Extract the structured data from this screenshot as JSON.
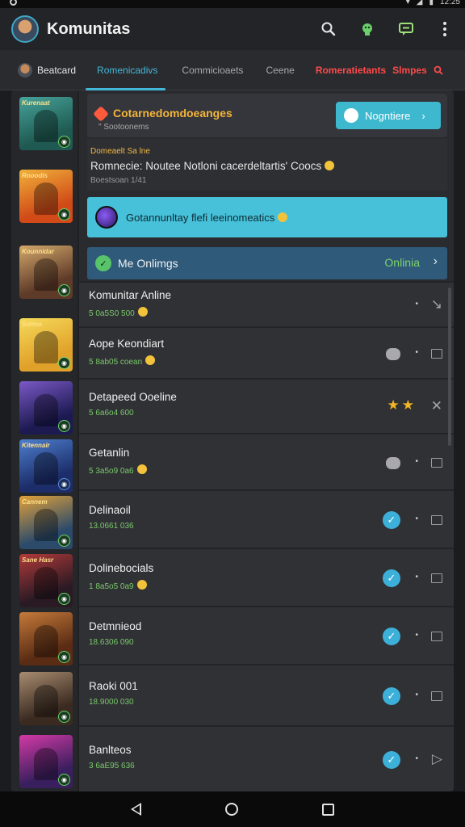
{
  "app": {
    "title": "Komunitas"
  },
  "statusbar": {
    "time": "12:25"
  },
  "appbar_icons": [
    "search-icon",
    "android-icon",
    "chat-icon",
    "more-vert-icon"
  ],
  "tabs": [
    {
      "label": "Beatcard"
    },
    {
      "label": "Romenicadivs"
    },
    {
      "label": "Commicioaets"
    },
    {
      "label": "Ceene"
    },
    {
      "label": "Romeratietants",
      "extra": "Slmpes"
    }
  ],
  "header": {
    "title": "Cotarnedomdoeanges",
    "sub": "\" Sootoonems",
    "join_label": "Nogntiere"
  },
  "notice": {
    "label": "Domeaelt Sa lne",
    "text": "Romnecie: Noutee Notloni cacerdeltartis' Coocs",
    "sub": "Boestsoan 1/41"
  },
  "banner": {
    "text": "Gotannunltay flefi leeinomeatics"
  },
  "online_bar": {
    "label": "Me Onlimgs",
    "status": "Onlinia"
  },
  "rows": [
    {
      "name": "Komunitar Anline",
      "sub": "5 0a5S0 500",
      "emoji": true,
      "dot": "•",
      "end": "arrow"
    },
    {
      "name": "Aope Keondiart",
      "sub": "5 8ab05 coean",
      "emoji": true,
      "dot": "•",
      "end": "box",
      "icon": "blob"
    },
    {
      "name": "Detapeed Ooeline",
      "sub": "5 6a6o4 600",
      "emoji": false,
      "end": "x",
      "icon": "stars"
    },
    {
      "name": "Getanlin",
      "sub": "5 3a5o9 0a6",
      "emoji": true,
      "dot": "•",
      "end": "box",
      "icon": "blob"
    },
    {
      "name": "Delinaoil",
      "sub": "13.0661 036",
      "emoji": false,
      "dot": "•",
      "end": "box",
      "icon": "check"
    },
    {
      "name": "Dolinebocials",
      "sub": "1 8a5o5 0a9",
      "emoji": true,
      "dot": "•",
      "end": "box",
      "icon": "check"
    },
    {
      "name": "Detmnieod",
      "sub": "18.6306 090",
      "emoji": false,
      "dot": "•",
      "end": "box",
      "icon": "check"
    },
    {
      "name": "Raoki 001",
      "sub": "18.9000 030",
      "emoji": false,
      "dot": "•",
      "end": "box",
      "icon": "check"
    },
    {
      "name": "Banlteos",
      "sub": "3 6aE95 636",
      "emoji": false,
      "dot": "•",
      "end": "play",
      "icon": "check"
    }
  ],
  "thumbs": [
    {
      "title": "Kurenaat",
      "colors": [
        "#1f5a52",
        "#46a39a"
      ]
    },
    {
      "title": "Rooodis",
      "colors": [
        "#d14a18",
        "#f0b13a"
      ]
    },
    {
      "title": "Kounnidar",
      "colors": [
        "#5e3a28",
        "#d3a86b"
      ]
    },
    {
      "title": "Sotmo",
      "colors": [
        "#e0a12a",
        "#f6da5a"
      ]
    },
    {
      "title": "",
      "colors": [
        "#1d1a52",
        "#7a59c6"
      ]
    },
    {
      "title": "Kitennair",
      "colors": [
        "#1c2d6a",
        "#4d7fcd"
      ]
    },
    {
      "title": "Cannem",
      "colors": [
        "#2c4a6a",
        "#e2a23a"
      ]
    },
    {
      "title": "Sane Hasr",
      "colors": [
        "#2a1a24",
        "#b13a3a"
      ]
    },
    {
      "title": "",
      "colors": [
        "#5a2c14",
        "#c57a3a"
      ]
    },
    {
      "title": "",
      "colors": [
        "#3a2a20",
        "#a88c70"
      ]
    },
    {
      "title": "",
      "colors": [
        "#3a1f5e",
        "#d43aa6"
      ]
    }
  ]
}
